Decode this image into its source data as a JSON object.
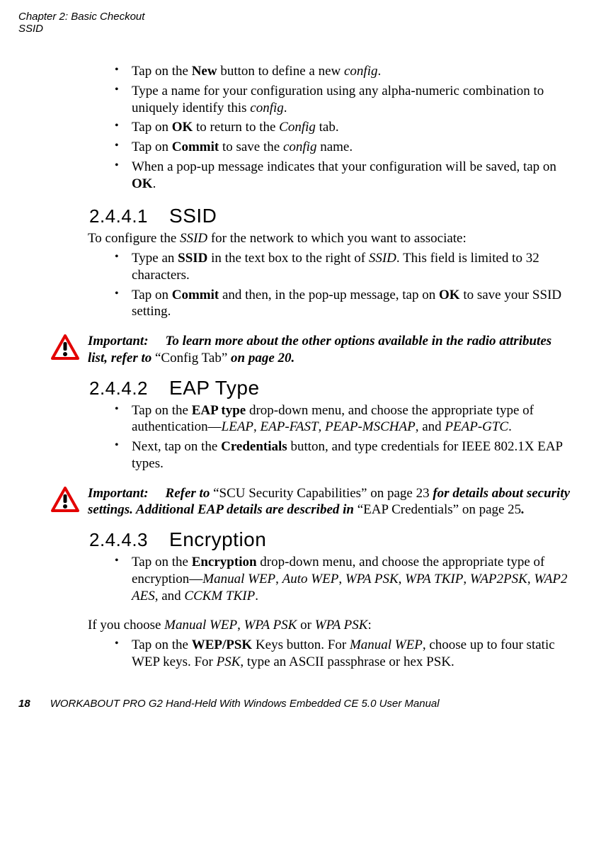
{
  "header": {
    "chapter_line": "Chapter 2: Basic Checkout",
    "section_line": "SSID"
  },
  "intro_bullets": {
    "b1a": "Tap on the ",
    "b1b": "New",
    "b1c": " button to define a new ",
    "b1d": "config",
    "b1e": ".",
    "b2a": "Type a name for your configuration using any alpha-numeric combination to uniquely identify this ",
    "b2b": "config",
    "b2c": ".",
    "b3a": "Tap on ",
    "b3b": "OK",
    "b3c": " to return to the ",
    "b3d": "Config",
    "b3e": " tab.",
    "b4a": "Tap on ",
    "b4b": "Commit",
    "b4c": " to save the ",
    "b4d": "config",
    "b4e": " name.",
    "b5a": "When a pop-up message indicates that your configuration will be saved, tap on ",
    "b5b": "OK",
    "b5c": "."
  },
  "s2441": {
    "num": "2.4.4.1",
    "title": "SSID",
    "p1a": "To configure the ",
    "p1b": "SSID",
    "p1c": " for the network to which you want to associate:",
    "b1a": "Type an ",
    "b1b": "SSID",
    "b1c": " in the text box to the right of ",
    "b1d": "SSID",
    "b1e": ". This field is limited to 32 characters.",
    "b2a": "Tap on ",
    "b2b": "Commit",
    "b2c": " and then, in the pop-up message, tap on ",
    "b2d": "OK",
    "b2e": " to save your SSID setting."
  },
  "imp1": {
    "label": "Important:",
    "t1": "To learn more about the other options available in the radio attributes list, refer to ",
    "q": "“Config Tab”",
    "t2": " on page 20."
  },
  "s2442": {
    "num": "2.4.4.2",
    "title": "EAP Type",
    "b1a": "Tap on the ",
    "b1b": "EAP type",
    "b1c": " drop-down menu, and choose the appropriate type of authentication—",
    "b1d": "LEAP",
    "b1e": ", ",
    "b1f": "EAP-FAST",
    "b1g": ", ",
    "b1h": "PEAP-MSCHAP",
    "b1i": ", and ",
    "b1j": "PEAP-GTC",
    "b1k": ".",
    "b2a": "Next, tap on the ",
    "b2b": "Credentials",
    "b2c": " button, and type credentials for IEEE 802.1X EAP types."
  },
  "imp2": {
    "label": "Important:",
    "t1": "Refer to ",
    "q1": "“SCU Security Capabilities” on page 23",
    "t2": " for details about security settings. Additional EAP details are described in ",
    "q2": "“EAP Credentials” on page 25",
    "t3": "."
  },
  "s2443": {
    "num": "2.4.4.3",
    "title": "Encryption",
    "b1a": "Tap on the ",
    "b1b": "Encryption",
    "b1c": " drop-down menu, and choose the appropriate type of encryption—",
    "b1d": "Manual WEP",
    "b1e": ", ",
    "b1f": "Auto WEP",
    "b1g": ", ",
    "b1h": "WPA PSK",
    "b1i": ", ",
    "b1j": "WPA TKIP",
    "b1k": ", ",
    "b1l": "WAP2PSK",
    "b1m": ", ",
    "b1n": "WAP2 AES",
    "b1o": ", and ",
    "b1p": "CCKM TKIP",
    "b1q": ".",
    "p1a": "If you choose ",
    "p1b": "Manual WEP",
    "p1c": ", ",
    "p1d": "WPA PSK",
    "p1e": " or ",
    "p1f": "WPA PSK",
    "p1g": ":",
    "b2a": "Tap on the ",
    "b2b": "WEP/PSK",
    "b2c": " Keys button. For ",
    "b2d": "Manual WEP",
    "b2e": ", choose up to four static WEP keys. For ",
    "b2f": "PSK",
    "b2g": ", type an ASCII passphrase or hex PSK."
  },
  "footer": {
    "page": "18",
    "title": "WORKABOUT PRO G2 Hand-Held With Windows Embedded CE 5.0 User Manual"
  }
}
